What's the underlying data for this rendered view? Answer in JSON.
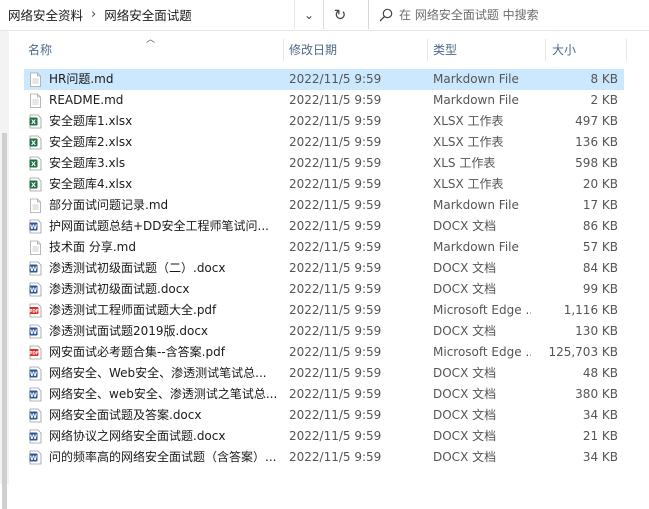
{
  "address": {
    "breadcrumbs": [
      "网络安全资料",
      "网络安全面试题"
    ],
    "separator": "›",
    "dropdown_glyph": "⌄",
    "refresh_glyph": "↻"
  },
  "search": {
    "placeholder": "在 网络安全面试题 中搜索"
  },
  "columns": {
    "name": "名称",
    "date": "修改日期",
    "type": "类型",
    "size": "大小",
    "sort_glyph": "︿"
  },
  "colors": {
    "selected_row": "#cce8ff",
    "header_text": "#4d6a8a",
    "excel_green": "#1e7145",
    "word_blue": "#2b5797",
    "pdf_red": "#d9302c"
  },
  "files": [
    {
      "name": "HR问题.md",
      "date": "2022/11/5 9:59",
      "type": "Markdown File",
      "size": "8 KB",
      "icon": "text-file-icon",
      "selected": true
    },
    {
      "name": "README.md",
      "date": "2022/11/5 9:59",
      "type": "Markdown File",
      "size": "2 KB",
      "icon": "text-file-icon"
    },
    {
      "name": "安全题库1.xlsx",
      "date": "2022/11/5 9:59",
      "type": "XLSX 工作表",
      "size": "497 KB",
      "icon": "excel-file-icon"
    },
    {
      "name": "安全题库2.xlsx",
      "date": "2022/11/5 9:59",
      "type": "XLSX 工作表",
      "size": "136 KB",
      "icon": "excel-file-icon"
    },
    {
      "name": "安全题库3.xls",
      "date": "2022/11/5 9:59",
      "type": "XLS 工作表",
      "size": "598 KB",
      "icon": "excel-file-icon"
    },
    {
      "name": "安全题库4.xlsx",
      "date": "2022/11/5 9:59",
      "type": "XLSX 工作表",
      "size": "20 KB",
      "icon": "excel-file-icon"
    },
    {
      "name": "部分面试问题记录.md",
      "date": "2022/11/5 9:59",
      "type": "Markdown File",
      "size": "17 KB",
      "icon": "text-file-icon"
    },
    {
      "name": "护网面试题总结+DD安全工程师笔试问...",
      "date": "2022/11/5 9:59",
      "type": "DOCX 文档",
      "size": "86 KB",
      "icon": "word-file-icon"
    },
    {
      "name": "技术面 分享.md",
      "date": "2022/11/5 9:59",
      "type": "Markdown File",
      "size": "57 KB",
      "icon": "text-file-icon"
    },
    {
      "name": "渗透测试初级面试题（二）.docx",
      "date": "2022/11/5 9:59",
      "type": "DOCX 文档",
      "size": "84 KB",
      "icon": "word-file-icon"
    },
    {
      "name": "渗透测试初级面试题.docx",
      "date": "2022/11/5 9:59",
      "type": "DOCX 文档",
      "size": "99 KB",
      "icon": "word-file-icon"
    },
    {
      "name": "渗透测试工程师面试题大全.pdf",
      "date": "2022/11/5 9:59",
      "type": "Microsoft Edge ...",
      "size": "1,116 KB",
      "icon": "pdf-file-icon"
    },
    {
      "name": "渗透测试面试题2019版.docx",
      "date": "2022/11/5 9:59",
      "type": "DOCX 文档",
      "size": "130 KB",
      "icon": "word-file-icon"
    },
    {
      "name": "网安面试必考题合集--含答案.pdf",
      "date": "2022/11/5 9:59",
      "type": "Microsoft Edge ...",
      "size": "125,703 KB",
      "icon": "pdf-file-icon"
    },
    {
      "name": "网络安全、Web安全、渗透测试笔试总...",
      "date": "2022/11/5 9:59",
      "type": "DOCX 文档",
      "size": "48 KB",
      "icon": "word-file-icon"
    },
    {
      "name": "网络安全、web安全、渗透测试之笔试总...",
      "date": "2022/11/5 9:59",
      "type": "DOCX 文档",
      "size": "380 KB",
      "icon": "word-file-icon"
    },
    {
      "name": "网络安全面试题及答案.docx",
      "date": "2022/11/5 9:59",
      "type": "DOCX 文档",
      "size": "34 KB",
      "icon": "word-file-icon"
    },
    {
      "name": "网络协议之网络安全面试题.docx",
      "date": "2022/11/5 9:59",
      "type": "DOCX 文档",
      "size": "21 KB",
      "icon": "word-file-icon"
    },
    {
      "name": "问的频率高的网络安全面试题（含答案）...",
      "date": "2022/11/5 9:59",
      "type": "DOCX 文档",
      "size": "34 KB",
      "icon": "word-file-icon"
    }
  ]
}
